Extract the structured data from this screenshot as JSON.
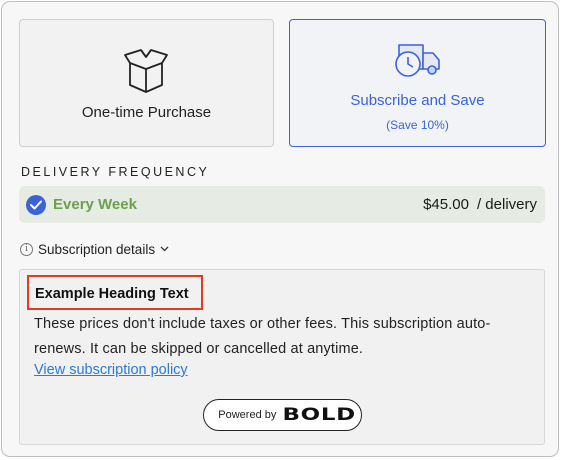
{
  "purchase_options": [
    {
      "label": "One-time Purchase",
      "icon": "open-box-icon",
      "selected": false
    },
    {
      "label": "Subscribe and Save",
      "sublabel": "(Save 10%)",
      "icon": "delivery-truck-clock-icon",
      "selected": true
    }
  ],
  "delivery": {
    "title": "DELIVERY FREQUENCY",
    "option_label": "Every Week",
    "price": "$45.00",
    "unit": "/ delivery"
  },
  "details": {
    "toggle_label": "Subscription details",
    "info_glyph": "i",
    "heading": "Example Heading Text",
    "body": "These prices don't include taxes or other fees. This subscription auto-renews. It can be skipped or cancelled at anytime.",
    "link_text": "View subscription policy"
  },
  "badge": {
    "prefix": "Powered by",
    "brand": "BOLD"
  },
  "colors": {
    "accent": "#3b63d6",
    "selected_text": "#6aa04e",
    "highlight_border": "#e33a24",
    "link": "#2a7ad6"
  }
}
